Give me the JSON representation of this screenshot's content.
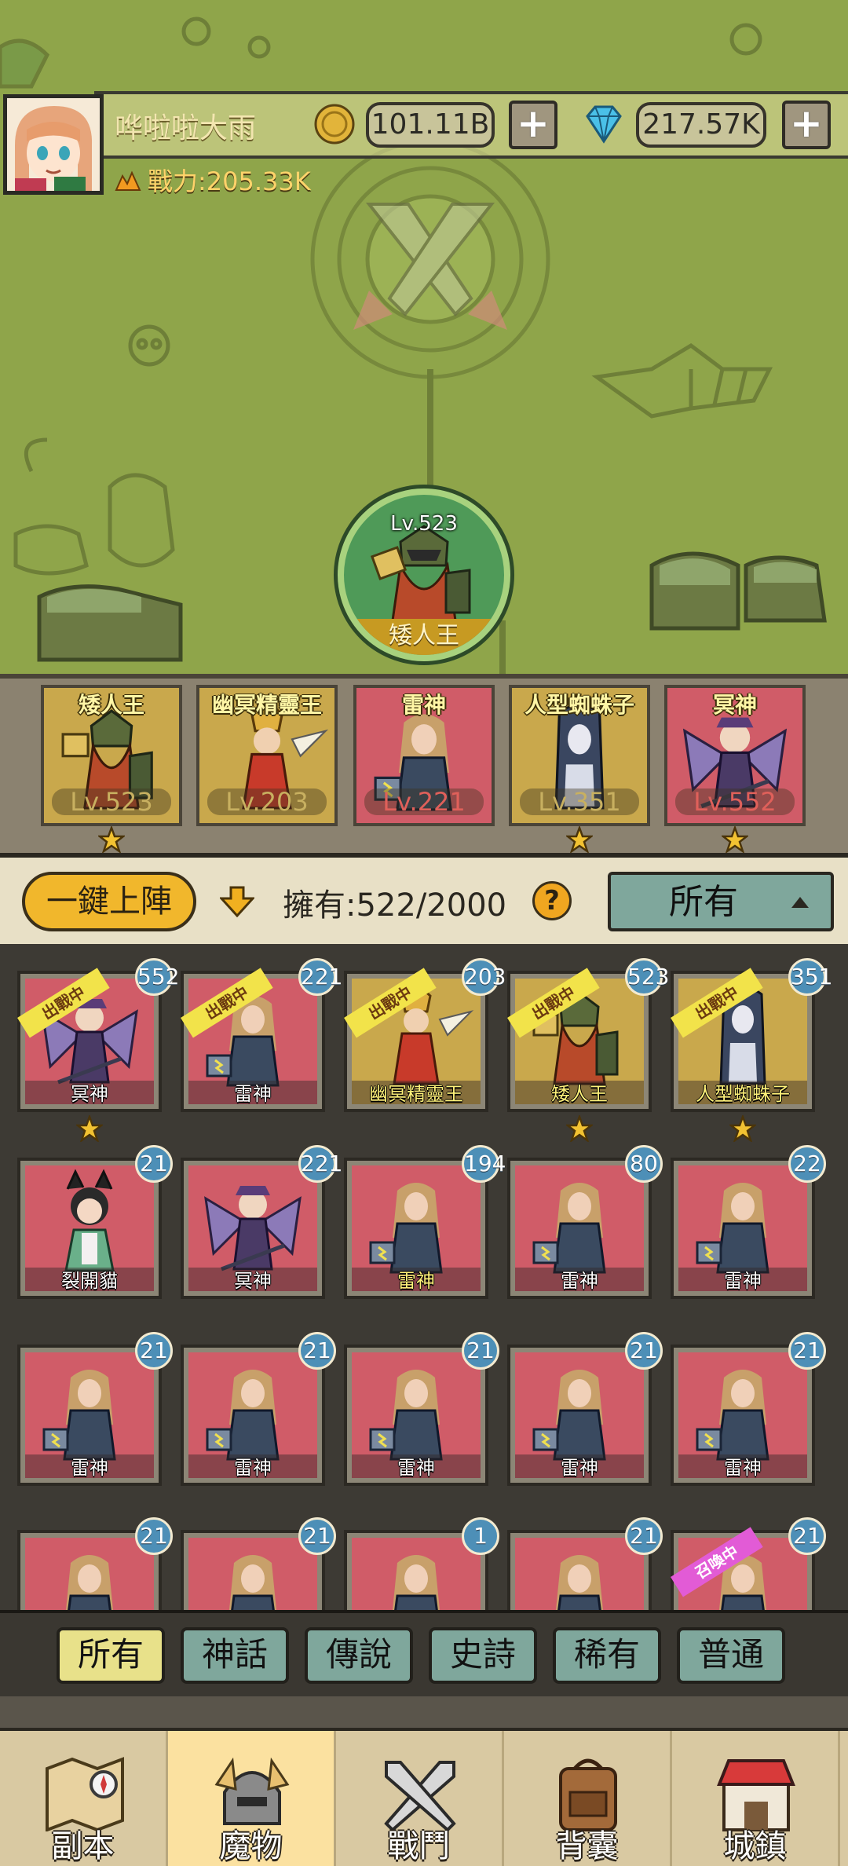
{
  "player": {
    "name": "哗啦啦大雨",
    "power": "戰力:205.33K",
    "gold": "101.11B",
    "gems": "217.57K"
  },
  "boss": {
    "level": "Lv.523",
    "name": "矮人王"
  },
  "lineup": [
    {
      "name": "矮人王",
      "level": "Lv.523",
      "starred": true,
      "bg": "gold"
    },
    {
      "name": "幽冥精靈王",
      "level": "Lv.203",
      "starred": false,
      "bg": "gold"
    },
    {
      "name": "雷神",
      "level": "Lv.221",
      "starred": false,
      "bg": "red"
    },
    {
      "name": "人型蜘蛛子",
      "level": "Lv.351",
      "starred": true,
      "bg": "gold"
    },
    {
      "name": "冥神",
      "level": "Lv.552",
      "starred": true,
      "bg": "red"
    }
  ],
  "controls": {
    "auto_deploy": "一鍵上陣",
    "owned": "擁有:522/2000",
    "help": "?",
    "filter": "所有"
  },
  "monsters": [
    {
      "name": "冥神",
      "count": "552",
      "tag": "出戰中",
      "starred": true,
      "bg": "red"
    },
    {
      "name": "雷神",
      "count": "221",
      "tag": "出戰中",
      "starred": false,
      "bg": "red"
    },
    {
      "name": "幽冥精靈王",
      "count": "203",
      "tag": "出戰中",
      "starred": false,
      "bg": "gold",
      "yellow": true
    },
    {
      "name": "矮人王",
      "count": "523",
      "tag": "出戰中",
      "starred": true,
      "bg": "gold",
      "yellow": true
    },
    {
      "name": "人型蜘蛛子",
      "count": "351",
      "tag": "出戰中",
      "starred": true,
      "bg": "gold",
      "yellow": true
    },
    {
      "name": "裂開貓",
      "count": "21",
      "bg": "red"
    },
    {
      "name": "冥神",
      "count": "221",
      "bg": "red"
    },
    {
      "name": "雷神",
      "count": "194",
      "bg": "red",
      "yellow": true
    },
    {
      "name": "雷神",
      "count": "80",
      "bg": "red"
    },
    {
      "name": "雷神",
      "count": "22",
      "bg": "red"
    },
    {
      "name": "雷神",
      "count": "21",
      "bg": "red"
    },
    {
      "name": "雷神",
      "count": "21",
      "bg": "red"
    },
    {
      "name": "雷神",
      "count": "21",
      "bg": "red"
    },
    {
      "name": "雷神",
      "count": "21",
      "bg": "red"
    },
    {
      "name": "雷神",
      "count": "21",
      "bg": "red"
    },
    {
      "name": "",
      "count": "21",
      "bg": "red"
    },
    {
      "name": "",
      "count": "21",
      "bg": "red"
    },
    {
      "name": "",
      "count": "1",
      "bg": "red"
    },
    {
      "name": "",
      "count": "21",
      "bg": "red"
    },
    {
      "name": "",
      "count": "21",
      "tag": "召喚中",
      "tag_color": "pink",
      "bg": "red"
    }
  ],
  "rarity_tabs": [
    "所有",
    "神話",
    "傳說",
    "史詩",
    "稀有",
    "普通"
  ],
  "nav": [
    {
      "label": "副本",
      "icon": "map-icon"
    },
    {
      "label": "魔物",
      "icon": "helmet-icon",
      "active": true
    },
    {
      "label": "戰鬥",
      "icon": "crossed-swords-icon"
    },
    {
      "label": "背囊",
      "icon": "backpack-icon"
    },
    {
      "label": "城鎮",
      "icon": "shop-icon"
    }
  ],
  "colors": {
    "map_green": "#8fa54a",
    "card_red": "#d05c68",
    "card_gold": "#c9a84c",
    "badge_blue": "#4d8fb7",
    "tab_teal": "#7fa79c",
    "tab_active": "#e8e18a",
    "button_orange": "#f1b72c"
  }
}
